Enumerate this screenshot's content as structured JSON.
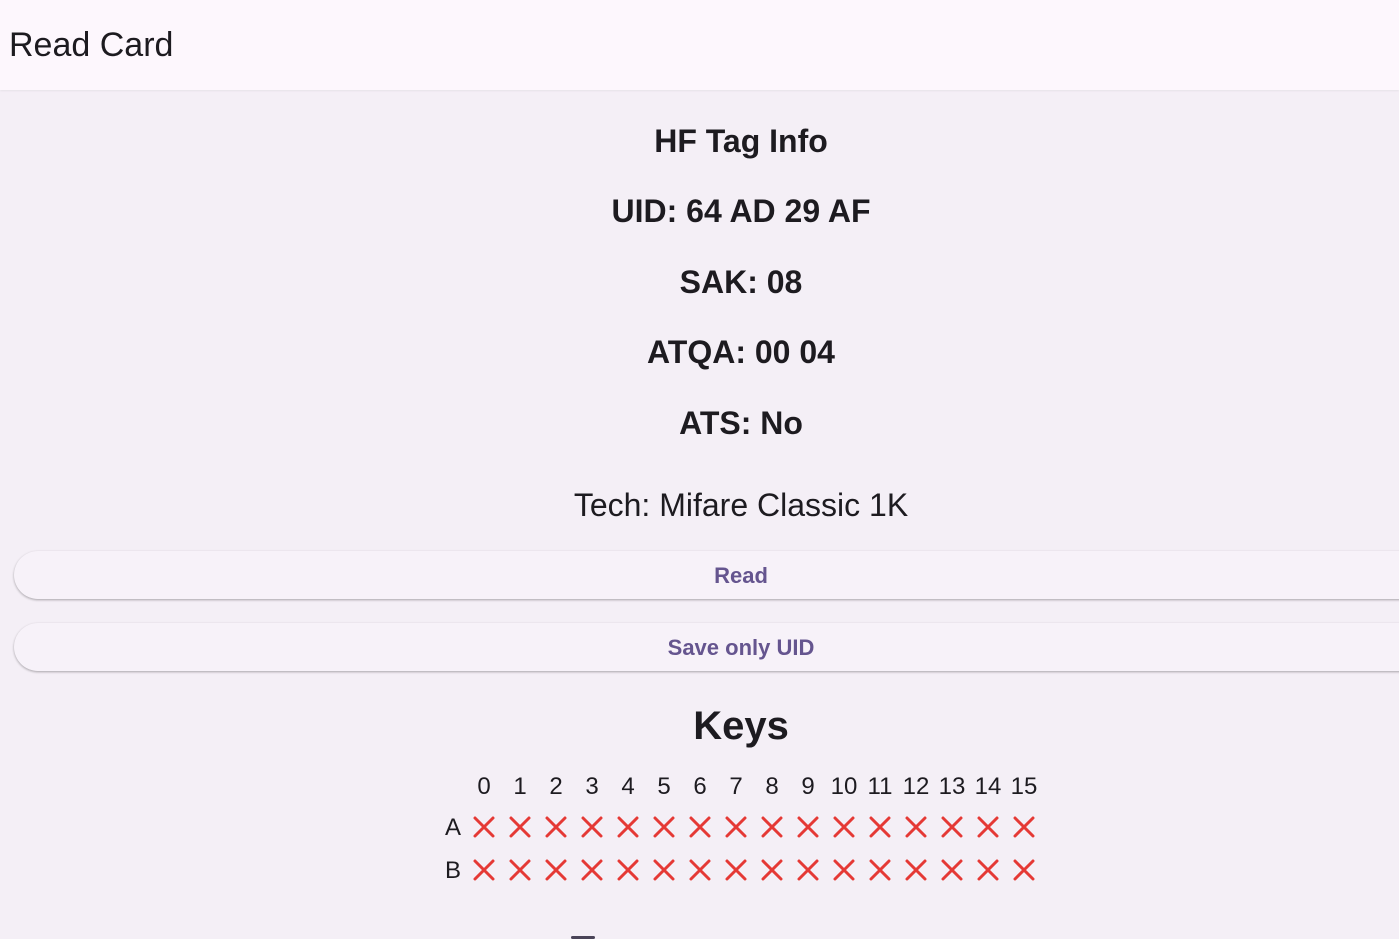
{
  "appbar": {
    "title": "Read Card"
  },
  "tag_info": {
    "heading": "HF Tag Info",
    "uid": "UID: 64 AD 29 AF",
    "sak": "SAK: 08",
    "atqa": "ATQA: 00 04",
    "ats": "ATS: No",
    "tech": "Tech: Mifare Classic 1K"
  },
  "buttons": {
    "read_label": "Read",
    "save_uid_label": "Save only UID"
  },
  "keys": {
    "title": "Keys",
    "sectors": [
      "0",
      "1",
      "2",
      "3",
      "4",
      "5",
      "6",
      "7",
      "8",
      "9",
      "10",
      "11",
      "12",
      "13",
      "14",
      "15"
    ],
    "rows": [
      {
        "label": "A",
        "status": [
          "missing",
          "missing",
          "missing",
          "missing",
          "missing",
          "missing",
          "missing",
          "missing",
          "missing",
          "missing",
          "missing",
          "missing",
          "missing",
          "missing",
          "missing",
          "missing"
        ]
      },
      {
        "label": "B",
        "status": [
          "missing",
          "missing",
          "missing",
          "missing",
          "missing",
          "missing",
          "missing",
          "missing",
          "missing",
          "missing",
          "missing",
          "missing",
          "missing",
          "missing",
          "missing",
          "missing"
        ]
      }
    ],
    "missing_icon": "close-icon",
    "missing_color": "#e53935"
  },
  "colors": {
    "appbar_bg": "#fdf7fd",
    "page_bg": "#f4eff6",
    "button_text": "#65558f",
    "text": "#1d1b20"
  }
}
